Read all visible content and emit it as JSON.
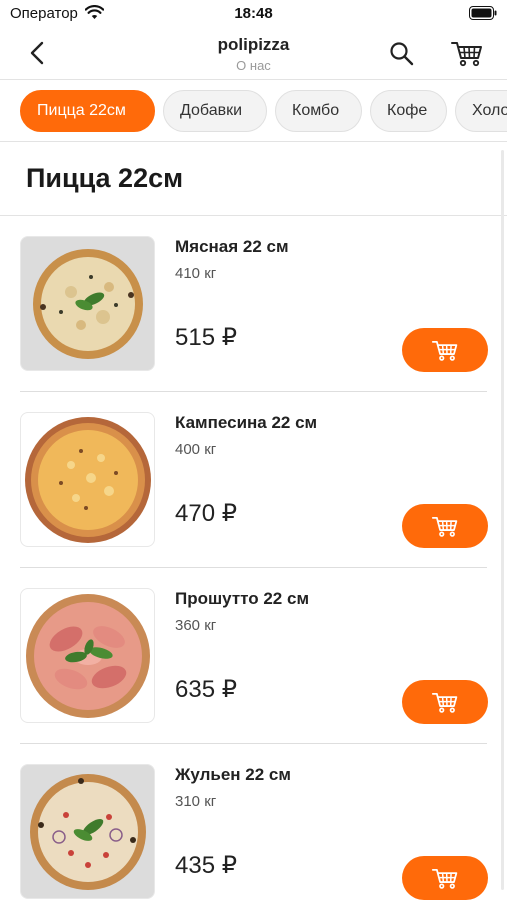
{
  "status_bar": {
    "carrier": "Оператор",
    "time": "18:48"
  },
  "nav": {
    "title": "polipizza",
    "subtitle": "О нас"
  },
  "categories": [
    {
      "label": "Пицца 22см",
      "active": true
    },
    {
      "label": "Добавки",
      "active": false
    },
    {
      "label": "Комбо",
      "active": false
    },
    {
      "label": "Кофе",
      "active": false
    },
    {
      "label": "Холо",
      "active": false
    }
  ],
  "section": {
    "title": "Пицца 22см"
  },
  "products": [
    {
      "name": "Мясная 22 см",
      "weight": "410 кг",
      "price": "515 ₽"
    },
    {
      "name": "Кампесина 22 см",
      "weight": "400 кг",
      "price": "470 ₽"
    },
    {
      "name": "Прошутто 22 см",
      "weight": "360 кг",
      "price": "635 ₽"
    },
    {
      "name": "Жульен 22 см",
      "weight": "310 кг",
      "price": "435 ₽"
    }
  ],
  "colors": {
    "accent": "#ff6a0a",
    "divider": "#e3e3e3",
    "chip_bg": "#f3f3f3"
  },
  "icons": {
    "back": "chevron-left-icon",
    "search": "search-icon",
    "cart": "cart-icon",
    "add_to_cart": "cart-icon"
  }
}
